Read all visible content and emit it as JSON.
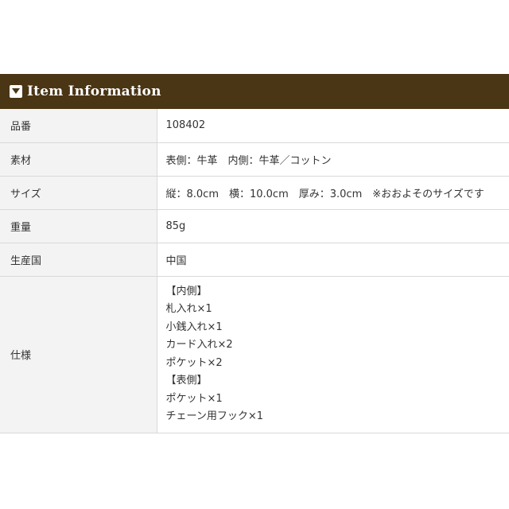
{
  "section": {
    "title": "Item Information",
    "icon": "caret-down-box-icon",
    "header_color": "#4a3514"
  },
  "rows": [
    {
      "label": "品番",
      "value": "108402"
    },
    {
      "label": "素材",
      "value": "表側：牛革　内側：牛革／コットン"
    },
    {
      "label": "サイズ",
      "value": "縦：8.0cm　横：10.0cm　厚み：3.0cm　※おおよそのサイズです"
    },
    {
      "label": "重量",
      "value": "85g"
    },
    {
      "label": "生産国",
      "value": "中国"
    }
  ],
  "spec": {
    "label": "仕様",
    "lines": [
      "【内側】",
      "札入れ×1",
      "小銭入れ×1",
      "カード入れ×2",
      "ポケット×2",
      "【表側】",
      "ポケット×1",
      "チェーン用フック×1"
    ]
  }
}
